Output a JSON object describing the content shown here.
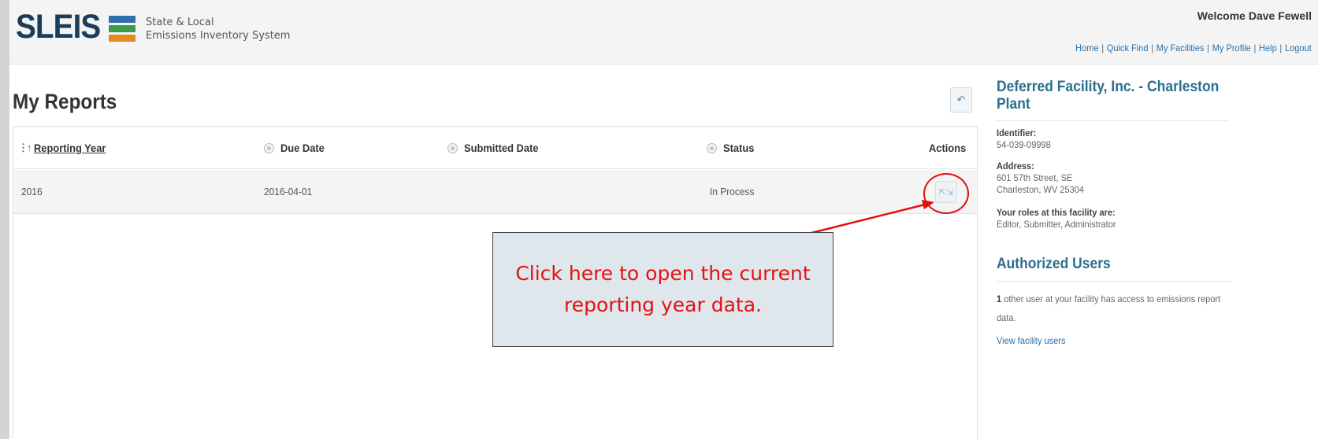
{
  "brand": {
    "logo": "SLEIS",
    "subtitle_line1": "State & Local",
    "subtitle_line2": "Emissions Inventory System",
    "flag_colors": [
      "#2f6fb0",
      "#3d9a47",
      "#e38a22"
    ]
  },
  "header": {
    "welcome": "Welcome Dave Fewell",
    "nav": [
      "Home",
      "Quick Find",
      "My Facilities",
      "My Profile",
      "Help",
      "Logout"
    ]
  },
  "main": {
    "title": "My Reports",
    "back_icon": "undo-arrow-icon",
    "columns": [
      "Reporting Year",
      "Due Date",
      "Submitted Date",
      "Status",
      "Actions"
    ],
    "rows": [
      {
        "year": "2016",
        "due": "2016-04-01",
        "submitted": "",
        "status": "In Process",
        "action_icon": "expand-icon"
      }
    ]
  },
  "callout": {
    "text": "Click here to open the current reporting year data.",
    "color": "#e31212"
  },
  "sidebar": {
    "facility_name": "Deferred Facility, Inc. - Charleston Plant",
    "identifier_label": "Identifier:",
    "identifier": "54-039-09998",
    "address_label": "Address:",
    "address_line1": "601 57th Street, SE",
    "address_line2": "Charleston, WV 25304",
    "roles_label": "Your roles at this facility are:",
    "roles": "Editor, Submitter, Administrator",
    "authorized_title": "Authorized Users",
    "authorized_count": "1",
    "authorized_text": "other user at your facility has access to emissions report data.",
    "view_users": "View facility users"
  }
}
